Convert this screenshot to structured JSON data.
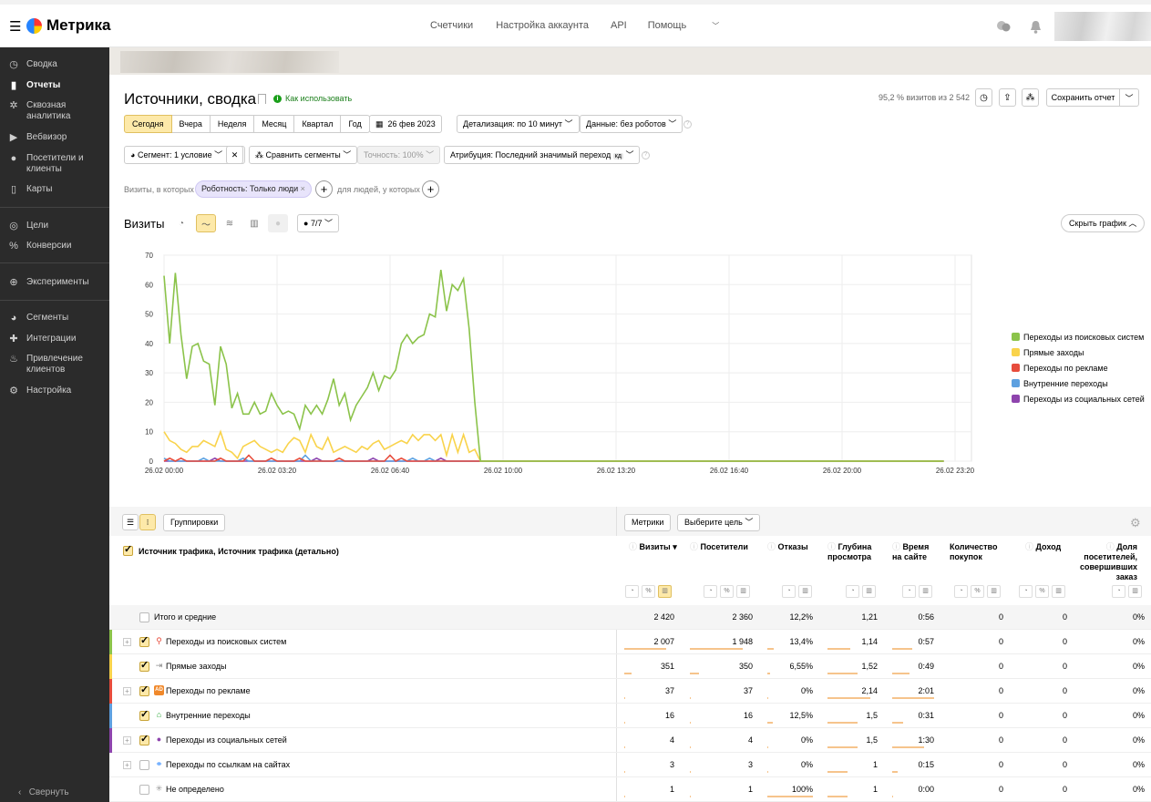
{
  "app": {
    "logo_text": "Метрика"
  },
  "topnav": [
    "Счетчики",
    "Настройка аккаунта",
    "API",
    "Помощь"
  ],
  "sidebar": {
    "items": [
      {
        "label": "Сводка",
        "icon": "dashboard-icon"
      },
      {
        "label": "Отчеты",
        "icon": "reports-icon",
        "active": true
      },
      {
        "label": "Сквозная аналитика",
        "icon": "crossanalytics-icon"
      },
      {
        "label": "Вебвизор",
        "icon": "play-icon"
      },
      {
        "label": "Посетители и клиенты",
        "icon": "user-icon"
      },
      {
        "label": "Карты",
        "icon": "map-icon"
      },
      {
        "label": "Цели",
        "icon": "target-icon"
      },
      {
        "label": "Конверсии",
        "icon": "percent-icon"
      },
      {
        "label": "Эксперименты",
        "icon": "ab-icon"
      },
      {
        "label": "Сегменты",
        "icon": "pie-icon"
      },
      {
        "label": "Интеграции",
        "icon": "puzzle-icon"
      },
      {
        "label": "Привлечение клиентов",
        "icon": "fire-icon"
      },
      {
        "label": "Настройка",
        "icon": "gear-icon"
      }
    ],
    "collapse": "Свернуть"
  },
  "report": {
    "title": "Источники, сводка",
    "howto": "Как использовать",
    "sampling": "95,2 % визитов из 2 542",
    "save": "Сохранить отчет"
  },
  "period": {
    "options": [
      "Сегодня",
      "Вчера",
      "Неделя",
      "Месяц",
      "Квартал",
      "Год"
    ],
    "selected": "Сегодня",
    "date": "26 фев 2023",
    "detail": "Детализация: по 10 минут",
    "data": "Данные: без роботов"
  },
  "filters": {
    "segment": "Сегмент: 1 условие",
    "compare": "Сравнить сегменты",
    "accuracy": "Точность: 100%",
    "attribution": "Атрибуция: Последний значимый переход",
    "attribution_badge": "кд",
    "visits_where": "Визиты, в которых",
    "tag": "Роботность: Только люди",
    "people_where": "для людей, у которых"
  },
  "chart_header": {
    "title": "Визиты",
    "goals": "7/7",
    "hide": "Скрыть график"
  },
  "chart_data": {
    "type": "line",
    "ylim": [
      0,
      70
    ],
    "yticks": [
      0,
      10,
      20,
      30,
      40,
      50,
      60,
      70
    ],
    "xticks": [
      "26.02 00:00",
      "26.02 03:20",
      "26.02 06:40",
      "26.02 10:00",
      "26.02 13:20",
      "26.02 16:40",
      "26.02 20:00",
      "26.02 23:20"
    ],
    "interval_minutes": 10,
    "legend_position": "right",
    "series": [
      {
        "name": "Переходы из поисковых систем",
        "color": "#8bc34a",
        "values": [
          63,
          40,
          64,
          43,
          28,
          39,
          40,
          34,
          33,
          19,
          39,
          33,
          18,
          23,
          16,
          16,
          20,
          16,
          17,
          23,
          19,
          16,
          17,
          16,
          11,
          19,
          16,
          19,
          16,
          21,
          28,
          19,
          23,
          14,
          19,
          22,
          25,
          30,
          24,
          29,
          28,
          31,
          40,
          43,
          40,
          42,
          43,
          50,
          49,
          65,
          51,
          60,
          58,
          62,
          45,
          20,
          0
        ]
      },
      {
        "name": "Прямые заходы",
        "color": "#f9d34b",
        "values": [
          10,
          7,
          6,
          4,
          3,
          5,
          5,
          7,
          6,
          5,
          10,
          4,
          3,
          1,
          5,
          6,
          7,
          5,
          4,
          3,
          4,
          3,
          6,
          8,
          7,
          3,
          9,
          5,
          4,
          8,
          3,
          4,
          5,
          4,
          3,
          5,
          4,
          6,
          7,
          4,
          5,
          6,
          7,
          6,
          9,
          7,
          9,
          9,
          7,
          9,
          2,
          9,
          3,
          9,
          3,
          4,
          0
        ]
      },
      {
        "name": "Переходы по рекламе",
        "color": "#e74c3c",
        "values": [
          0,
          1,
          0,
          1,
          0,
          0,
          0,
          0,
          0,
          0,
          1,
          0,
          0,
          0,
          0,
          2,
          0,
          0,
          0,
          1,
          0,
          0,
          0,
          0,
          1,
          0,
          0,
          0,
          0,
          0,
          0,
          1,
          0,
          0,
          0,
          0,
          0,
          0,
          0,
          0,
          2,
          0,
          1,
          0,
          0,
          0,
          0,
          0,
          0,
          0,
          0,
          0,
          0,
          0,
          0,
          0,
          0
        ]
      },
      {
        "name": "Внутренние переходы",
        "color": "#5da0e0",
        "values": [
          1,
          0,
          0,
          0,
          0,
          0,
          0,
          1,
          0,
          0,
          0,
          0,
          0,
          0,
          1,
          0,
          0,
          0,
          0,
          0,
          0,
          0,
          0,
          0,
          0,
          2,
          0,
          0,
          0,
          0,
          0,
          0,
          0,
          0,
          0,
          0,
          0,
          0,
          0,
          0,
          0,
          0,
          0,
          0,
          1,
          0,
          0,
          1,
          0,
          0,
          0,
          0,
          0,
          0,
          0,
          0,
          0
        ]
      },
      {
        "name": "Переходы из социальных сетей",
        "color": "#8e44ad",
        "values": [
          0,
          0,
          0,
          0,
          0,
          0,
          0,
          0,
          0,
          1,
          0,
          0,
          0,
          0,
          0,
          0,
          0,
          0,
          0,
          0,
          0,
          0,
          0,
          0,
          0,
          0,
          0,
          1,
          0,
          0,
          0,
          0,
          0,
          0,
          0,
          0,
          0,
          1,
          0,
          0,
          0,
          0,
          0,
          0,
          0,
          0,
          0,
          0,
          0,
          1,
          0,
          0,
          0,
          0,
          0,
          0,
          0
        ]
      }
    ]
  },
  "table": {
    "groupings": "Группировки",
    "metrics_btn": "Метрики",
    "goal_btn": "Выберите цель",
    "dimension": "Источник трафика, Источник трафика (детально)",
    "columns": [
      {
        "label": "Визиты",
        "sorted": "▾"
      },
      {
        "label": "Посетители"
      },
      {
        "label": "Отказы"
      },
      {
        "label": "Глубина просмотра"
      },
      {
        "label": "Время на сайте"
      },
      {
        "label": "Количество покупок"
      },
      {
        "label": "Доход"
      },
      {
        "label": "Доля посетителей, совершивших заказ"
      }
    ],
    "total": {
      "label": "Итого и средние",
      "values": [
        "2 420",
        "2 360",
        "12,2%",
        "1,21",
        "0:56",
        "0",
        "0",
        "0%"
      ]
    },
    "rows": [
      {
        "label": "Переходы из поисковых систем",
        "icon": "search-icon",
        "color": "#8bc34a",
        "expand": true,
        "checked": true,
        "values": [
          "2 007",
          "1 948",
          "13,4%",
          "1,14",
          "0:57",
          "0",
          "0",
          "0%"
        ]
      },
      {
        "label": "Прямые заходы",
        "icon": "direct-icon",
        "color": "#f9d34b",
        "expand": false,
        "checked": true,
        "values": [
          "351",
          "350",
          "6,55%",
          "1,52",
          "0:49",
          "0",
          "0",
          "0%"
        ]
      },
      {
        "label": "Переходы по рекламе",
        "icon": "ad-icon",
        "color": "#e74c3c",
        "expand": true,
        "checked": true,
        "values": [
          "37",
          "37",
          "0%",
          "2,14",
          "2:01",
          "0",
          "0",
          "0%"
        ]
      },
      {
        "label": "Внутренние переходы",
        "icon": "home-icon",
        "color": "#5da0e0",
        "expand": false,
        "checked": true,
        "values": [
          "16",
          "16",
          "12,5%",
          "1,5",
          "0:31",
          "0",
          "0",
          "0%"
        ]
      },
      {
        "label": "Переходы из социальных сетей",
        "icon": "social-icon",
        "color": "#8e44ad",
        "expand": true,
        "checked": true,
        "values": [
          "4",
          "4",
          "0%",
          "1,5",
          "1:30",
          "0",
          "0",
          "0%"
        ]
      },
      {
        "label": "Переходы по ссылкам на сайтах",
        "icon": "link-icon",
        "color": "",
        "expand": true,
        "checked": false,
        "values": [
          "3",
          "3",
          "0%",
          "1",
          "0:15",
          "0",
          "0",
          "0%"
        ]
      },
      {
        "label": "Не определено",
        "icon": "spinner-icon",
        "color": "",
        "expand": false,
        "checked": false,
        "values": [
          "1",
          "1",
          "100%",
          "1",
          "0:00",
          "0",
          "0",
          "0%"
        ]
      }
    ]
  }
}
